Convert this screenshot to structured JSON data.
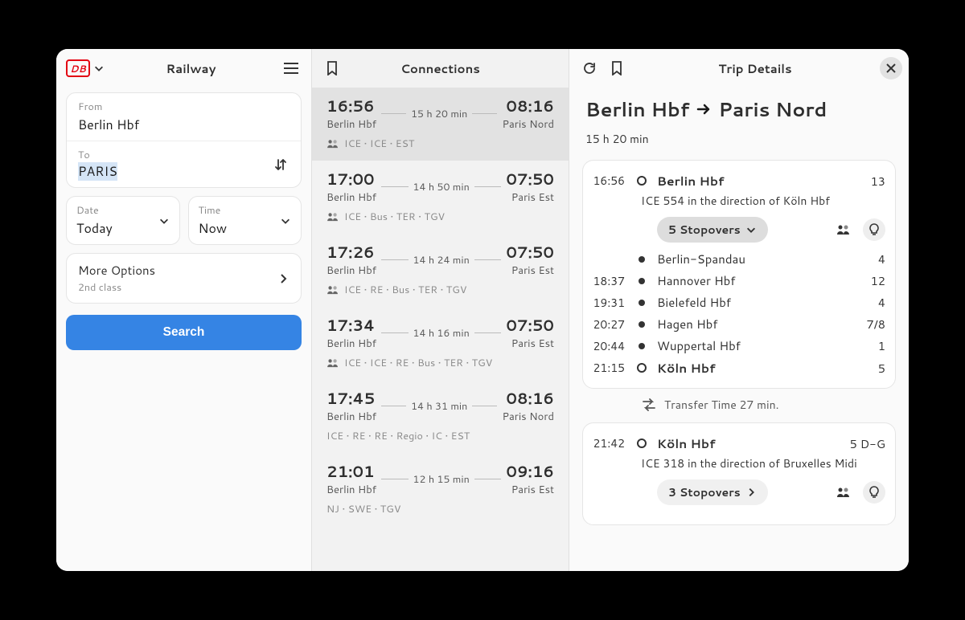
{
  "app": {
    "title": "Railway",
    "provider": "DB"
  },
  "search": {
    "from_label": "From",
    "from_value": "Berlin Hbf",
    "to_label": "To",
    "to_value": "PARIS",
    "date_label": "Date",
    "date_value": "Today",
    "time_label": "Time",
    "time_value": "Now",
    "more_options": "More Options",
    "more_options_sub": "2nd class",
    "search_button": "Search"
  },
  "connections": {
    "title": "Connections",
    "items": [
      {
        "dep_time": "16:56",
        "dep_station": "Berlin Hbf",
        "duration": "15 h 20 min",
        "arr_time": "08:16",
        "arr_station": "Paris Nord",
        "types": "ICE • ICE • EST",
        "load": true,
        "selected": true
      },
      {
        "dep_time": "17:00",
        "dep_station": "Berlin Hbf",
        "duration": "14 h 50 min",
        "arr_time": "07:50",
        "arr_station": "Paris Est",
        "types": "ICE • Bus • TER • TGV",
        "load": true,
        "selected": false
      },
      {
        "dep_time": "17:26",
        "dep_station": "Berlin Hbf",
        "duration": "14 h 24 min",
        "arr_time": "07:50",
        "arr_station": "Paris Est",
        "types": "ICE • RE • Bus • TER • TGV",
        "load": true,
        "selected": false
      },
      {
        "dep_time": "17:34",
        "dep_station": "Berlin Hbf",
        "duration": "14 h 16 min",
        "arr_time": "07:50",
        "arr_station": "Paris Est",
        "types": "ICE • ICE • RE • Bus • TER • TGV",
        "load": true,
        "selected": false
      },
      {
        "dep_time": "17:45",
        "dep_station": "Berlin Hbf",
        "duration": "14 h 31 min",
        "arr_time": "08:16",
        "arr_station": "Paris Nord",
        "types": "ICE • RE • RE • Regio • IC • EST",
        "load": false,
        "selected": false
      },
      {
        "dep_time": "21:01",
        "dep_station": "Berlin Hbf",
        "duration": "12 h 15 min",
        "arr_time": "09:16",
        "arr_station": "Paris Est",
        "types": "NJ • SWE • TGV",
        "load": false,
        "selected": false
      }
    ]
  },
  "trip": {
    "title": "Trip Details",
    "from": "Berlin Hbf",
    "to": "Paris Nord",
    "duration": "15 h 20 min",
    "segments": [
      {
        "dep_time": "16:56",
        "dep_station": "Berlin Hbf",
        "dep_platform": "13",
        "train": "ICE 554 in the direction of Köln Hbf",
        "stopovers_label": "5 Stopovers",
        "stopovers_expanded": true,
        "stops": [
          {
            "time": "",
            "name": "Berlin-Spandau",
            "platform": "4"
          },
          {
            "time": "18:37",
            "name": "Hannover Hbf",
            "platform": "12"
          },
          {
            "time": "19:31",
            "name": "Bielefeld Hbf",
            "platform": "4"
          },
          {
            "time": "20:27",
            "name": "Hagen Hbf",
            "platform": "7/8"
          },
          {
            "time": "20:44",
            "name": "Wuppertal Hbf",
            "platform": "1"
          }
        ],
        "arr_time": "21:15",
        "arr_station": "Köln Hbf",
        "arr_platform": "5"
      },
      {
        "dep_time": "21:42",
        "dep_station": "Köln Hbf",
        "dep_platform": "5 D-G",
        "train": "ICE 318 in the direction of Bruxelles Midi",
        "stopovers_label": "3 Stopovers",
        "stopovers_expanded": false
      }
    ],
    "transfer": "Transfer Time 27 min."
  }
}
